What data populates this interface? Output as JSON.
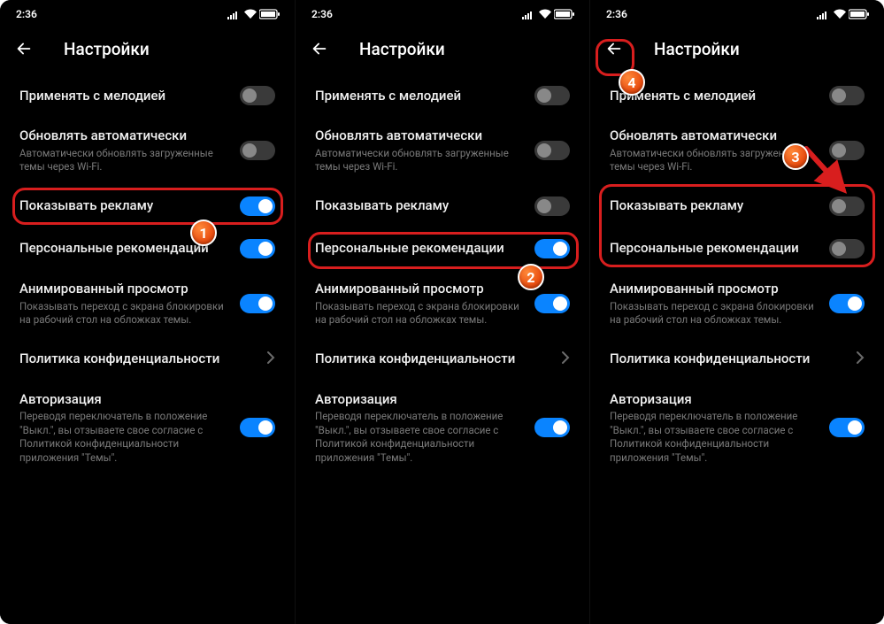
{
  "status_time": "2:36",
  "header_title": "Настройки",
  "rows": {
    "melody": {
      "title": "Применять с мелодией"
    },
    "auto_update": {
      "title": "Обновлять автоматически",
      "sub": "Автоматически обновлять загруженные темы через Wi-Fi."
    },
    "show_ads": {
      "title": "Показывать рекламу"
    },
    "personal_rec": {
      "title": "Персональные рекомендации"
    },
    "anim_preview": {
      "title": "Анимированный просмотр",
      "sub": "Показывать переход с экрана блокировки на рабочий стол на обложках темы."
    },
    "privacy": {
      "title": "Политика конфиденциальности"
    },
    "auth": {
      "title": "Авторизация",
      "sub": "Переводя переключатель в положение \"Выкл.\", вы отзываете свое согласие с Политикой конфиденциальности приложения \"Темы\"."
    }
  },
  "badges": {
    "b1": "1",
    "b2": "2",
    "b3": "3",
    "b4": "4"
  },
  "screens": [
    {
      "show_ads_on": true,
      "personal_on": true
    },
    {
      "show_ads_on": false,
      "personal_on": true
    },
    {
      "show_ads_on": false,
      "personal_on": false
    }
  ]
}
